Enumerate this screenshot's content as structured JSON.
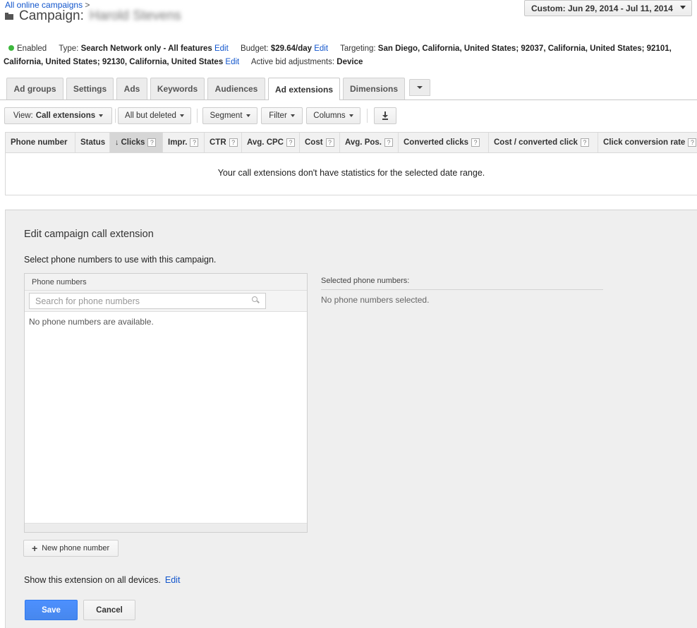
{
  "breadcrumb": {
    "link": "All online campaigns",
    "sep": ">"
  },
  "header": {
    "prefix": "Campaign:",
    "name": "Harold Stevens"
  },
  "date_range": {
    "label": "Custom: Jun 29, 2014 - Jul 11, 2014"
  },
  "info": {
    "status": "Enabled",
    "type_label": "Type:",
    "type_value": "Search Network only - All features",
    "budget_label": "Budget:",
    "budget_value": "$29.64/day",
    "targeting_label": "Targeting:",
    "targeting_value": "San Diego, California, United States; 92037, California, United States; 92101, California, United States; 92130, California, United States",
    "bid_label": "Active bid adjustments:",
    "bid_value": "Device",
    "edit": "Edit",
    "status_color": "#3cb73c"
  },
  "tabs": [
    "Ad groups",
    "Settings",
    "Ads",
    "Keywords",
    "Audiences",
    "Ad extensions",
    "Dimensions"
  ],
  "active_tab": "Ad extensions",
  "toolbar": {
    "view_prefix": "View:",
    "view_value": "Call extensions",
    "filter_deleted": "All but deleted",
    "segment": "Segment",
    "filter": "Filter",
    "columns": "Columns"
  },
  "table": {
    "columns": [
      "Phone number",
      "Status",
      "Clicks",
      "Impr.",
      "CTR",
      "Avg. CPC",
      "Cost",
      "Avg. Pos.",
      "Converted clicks",
      "Cost / converted click",
      "Click conversion rate"
    ],
    "help_marker": "?",
    "sort_marker": "↓",
    "sorted_column": "Clicks",
    "empty_message": "Your call extensions don't have statistics for the selected date range."
  },
  "edit_panel": {
    "title": "Edit campaign call extension",
    "subtitle": "Select phone numbers to use with this campaign.",
    "phone_numbers_header": "Phone numbers",
    "search_placeholder": "Search for phone numbers",
    "no_available": "No phone numbers are available.",
    "selected_header": "Selected phone numbers:",
    "none_selected": "No phone numbers selected.",
    "new_phone_button": "New phone number",
    "devices_text": "Show this extension on all devices.",
    "devices_edit": "Edit",
    "save": "Save",
    "cancel": "Cancel",
    "accent_color": "#4d90fe"
  }
}
